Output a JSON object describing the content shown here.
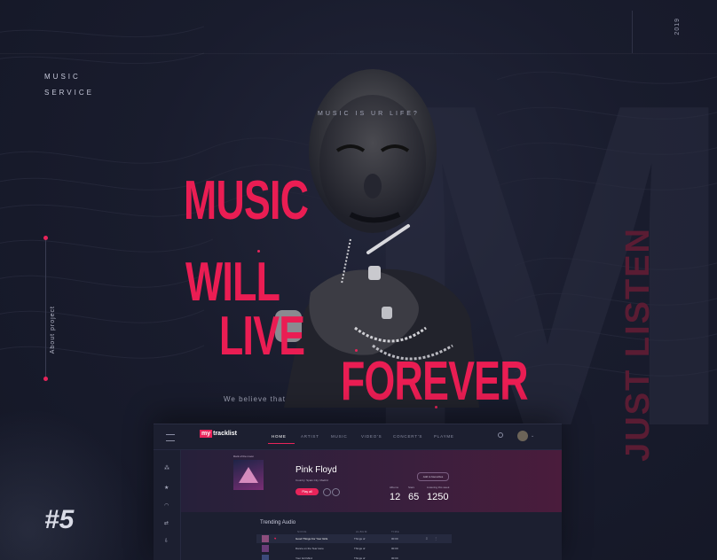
{
  "brand": {
    "line1": "MUSIC",
    "line2": "SERVICE"
  },
  "year": "2019",
  "about": "About project",
  "tagline": "MUSIC IS UR LIFE?",
  "headline": {
    "w1": "MUSIC",
    "w2": "WILL",
    "w3": "LIVE",
    "w4": "FOREVER"
  },
  "believe": "We believe that",
  "vertical_slogan": "JUST LISTEN",
  "project_number": "#5",
  "app": {
    "logo_prefix": "my",
    "logo_text": "tracklist",
    "nav": [
      "HOME",
      "ARTIST",
      "MUSIC",
      "VIDEO'S",
      "CONCERT'S",
      "PLAYME"
    ],
    "active_nav": "HOME",
    "cover_label": "Dark of the moon",
    "artist": "Pink Floyd",
    "meta": "Country: Spain   City: Madrid",
    "play_label": "Play all",
    "fav_label": "Add to favourites",
    "stats": [
      {
        "label": "Albums",
        "value": "12"
      },
      {
        "label": "Stars",
        "value": "65"
      },
      {
        "label": "Listening this week",
        "value": "1250"
      }
    ],
    "trending_title": "Trending Audio",
    "columns": [
      "SONG",
      "ALBUM",
      "TIME"
    ],
    "rows": [
      {
        "song": "Good Things For Your Girls",
        "album": "Things of",
        "time": "00:00"
      },
      {
        "song": "Dance on the Tear Here",
        "album": "Things of",
        "time": "00:00"
      },
      {
        "song": "Your Girl Mind",
        "album": "Things of",
        "time": "00:00"
      }
    ]
  },
  "colors": {
    "accent": "#e8245a",
    "background": "#171a2b"
  }
}
